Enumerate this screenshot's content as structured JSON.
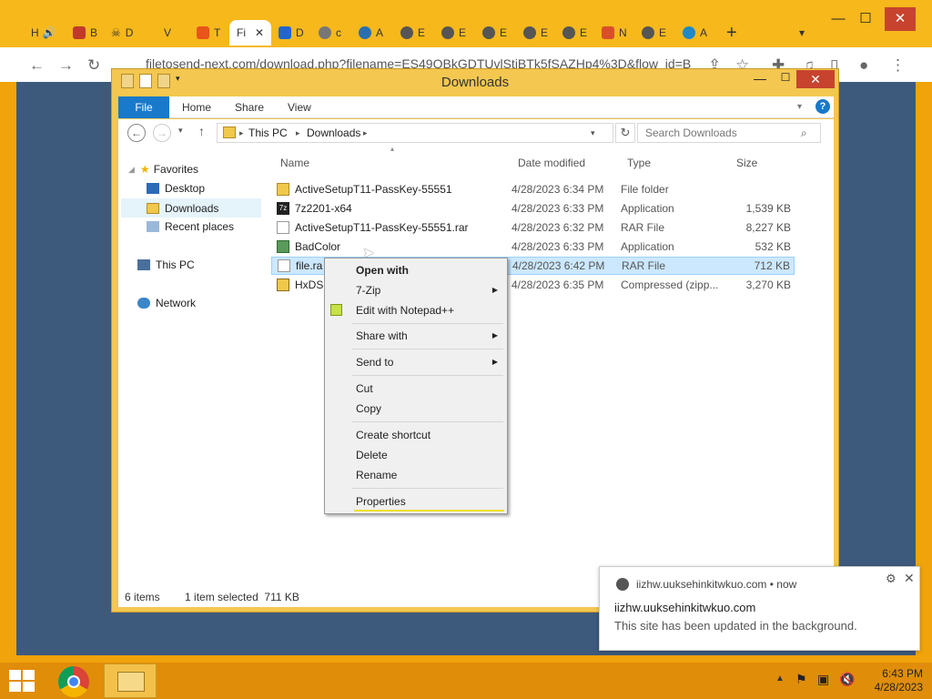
{
  "browser": {
    "tabs": [
      "H",
      "B",
      "D",
      "V",
      "T",
      "Fi",
      "D",
      "c",
      "A",
      "E",
      "E",
      "E",
      "E",
      "E",
      "N",
      "E",
      "A"
    ],
    "url": "filetosend-next.com/download.php?filename=ES49QBkGDTUvlStiBTk5fSAZHp4%3D&flow_id=B"
  },
  "explorer": {
    "title": "Downloads",
    "ribbon_tabs": [
      "File",
      "Home",
      "Share",
      "View"
    ],
    "breadcrumb": [
      "This PC",
      "Downloads"
    ],
    "search_placeholder": "Search Downloads",
    "nav": {
      "favorites": "Favorites",
      "desktop": "Desktop",
      "downloads": "Downloads",
      "recent": "Recent places",
      "thispc": "This PC",
      "network": "Network"
    },
    "columns": {
      "name": "Name",
      "date": "Date modified",
      "type": "Type",
      "size": "Size"
    },
    "files": [
      {
        "name": "ActiveSetupT11-PassKey-55551",
        "date": "4/28/2023 6:34 PM",
        "type": "File folder",
        "size": ""
      },
      {
        "name": "7z2201-x64",
        "date": "4/28/2023 6:33 PM",
        "type": "Application",
        "size": "1,539 KB"
      },
      {
        "name": "ActiveSetupT11-PassKey-55551.rar",
        "date": "4/28/2023 6:32 PM",
        "type": "RAR File",
        "size": "8,227 KB"
      },
      {
        "name": "BadColor",
        "date": "4/28/2023 6:33 PM",
        "type": "Application",
        "size": "532 KB"
      },
      {
        "name": "file.ra",
        "date": "4/28/2023 6:42 PM",
        "type": "RAR File",
        "size": "712 KB"
      },
      {
        "name": "HxDS",
        "date": "4/28/2023 6:35 PM",
        "type": "Compressed (zipp...",
        "size": "3,270 KB"
      }
    ],
    "status_items": "6 items",
    "status_selected": "1 item selected  711 KB"
  },
  "context_menu": {
    "open_with": "Open with",
    "zip": "7-Zip",
    "notepad": "Edit with Notepad++",
    "share_with": "Share with",
    "send_to": "Send to",
    "cut": "Cut",
    "copy": "Copy",
    "create_shortcut": "Create shortcut",
    "delete": "Delete",
    "rename": "Rename",
    "properties": "Properties"
  },
  "notification": {
    "origin": "iizhw.uuksehinkitwkuo.com",
    "time": "now",
    "title": "iizhw.uuksehinkitwkuo.com",
    "body": "This site has been updated in the background."
  },
  "taskbar": {
    "time": "6:43 PM",
    "date": "4/28/2023"
  },
  "colors": {
    "accent": "#1979ca",
    "chrome_frame": "#f6b81b",
    "desktop": "#3d5a7c",
    "close": "#c7432e"
  }
}
